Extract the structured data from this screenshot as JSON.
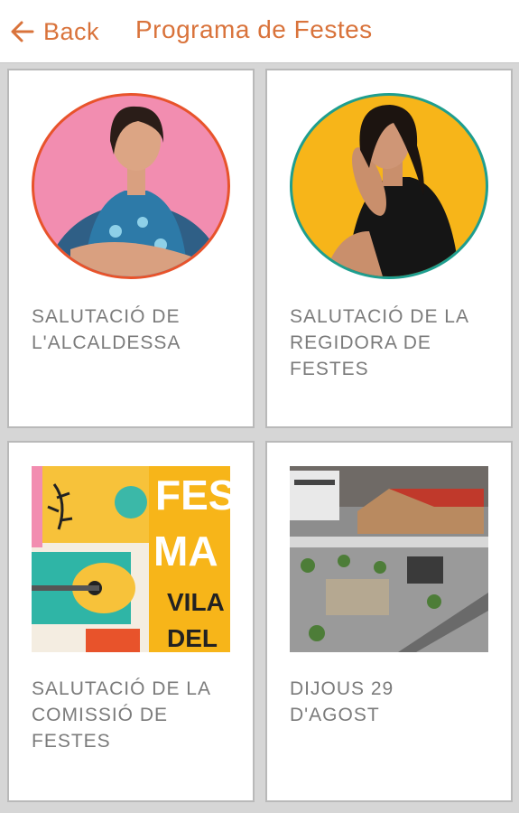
{
  "header": {
    "back_label": "Back",
    "title": "Programa de Festes"
  },
  "colors": {
    "accent": "#d9733b",
    "card_text": "#7b7b7b",
    "background": "#d6d6d6"
  },
  "cards": [
    {
      "lines": [
        "SALUTACIÓ DE",
        "L'ALCALDESSA"
      ],
      "image": "mayor-portrait"
    },
    {
      "lines": [
        "SALUTACIÓ DE LA",
        "REGIDORA DE",
        "FESTES"
      ],
      "image": "councillor-portrait"
    },
    {
      "lines": [
        "SALUTACIÓ DE LA",
        "COMISSIÓ DE",
        "FESTES"
      ],
      "image": "festival-poster",
      "poster_text": [
        "FES",
        "MA",
        "VILA",
        "DEL"
      ]
    },
    {
      "lines": [
        "DIJOUS 29",
        "D'AGOST"
      ],
      "image": "town-square-photo"
    }
  ]
}
